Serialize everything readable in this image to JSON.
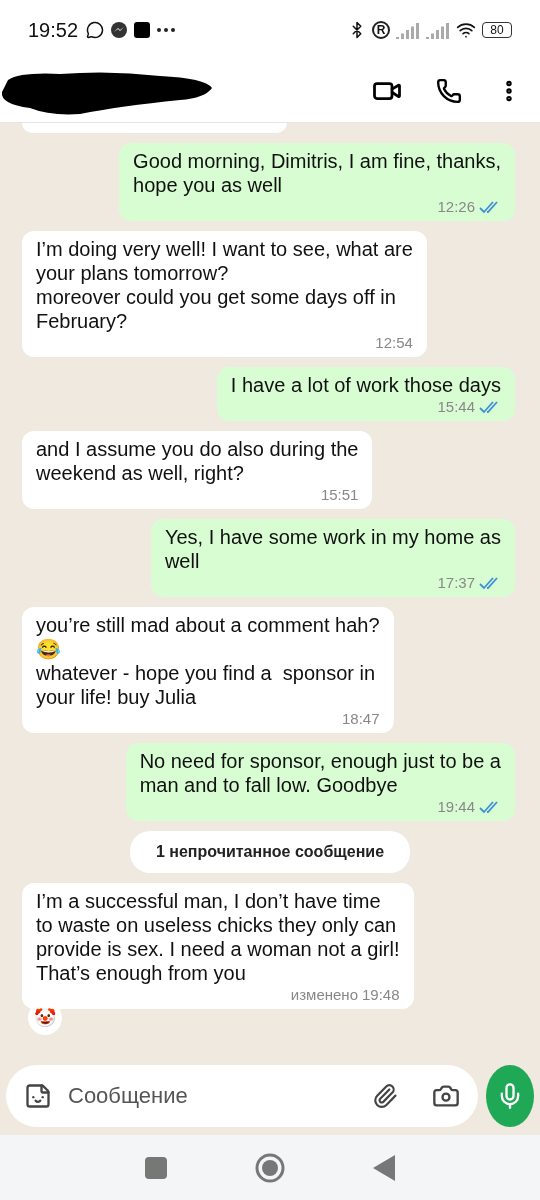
{
  "status_bar": {
    "time": "19:52",
    "roaming": "R",
    "battery": "80"
  },
  "chat_header": {
    "redacted": true
  },
  "messages": [
    {
      "kind": "out",
      "text": "Good morning, Dimitris, I am fine, thanks,\nhope you as well",
      "time": "12:26",
      "read": true
    },
    {
      "kind": "in",
      "text": "I’m doing very well! I want to see, what are\nyour plans tomorrow?\nmoreover could you get some days off in\nFebruary?",
      "time": "12:54"
    },
    {
      "kind": "out",
      "text": "I have a lot of work those days",
      "time": "15:44",
      "read": true
    },
    {
      "kind": "in",
      "text": "and I assume you do also during the\nweekend as well, right?",
      "time": "15:51"
    },
    {
      "kind": "out",
      "text": "Yes, I have some work in my home as\nwell",
      "time": "17:37",
      "read": true
    },
    {
      "kind": "in",
      "text": "you’re still mad about a comment hah?\n😂\nwhatever - hope you find a  sponsor in\nyour life! buy Julia",
      "time": "18:47"
    },
    {
      "kind": "out",
      "text": "No need for sponsor, enough just to be a\nman and to fall low. Goodbye",
      "time": "19:44",
      "read": true
    },
    {
      "kind": "divider",
      "text": "1 непрочитанное сообщение"
    },
    {
      "kind": "in",
      "text": "I’m a successful man, I don’t have time\nto waste on useless chicks they only can\nprovide is sex. I need a woman not a girl!\nThat’s enough from you",
      "edited": "изменено",
      "time": "19:48",
      "reaction": "🤡"
    }
  ],
  "composer": {
    "placeholder": "Сообщение"
  }
}
